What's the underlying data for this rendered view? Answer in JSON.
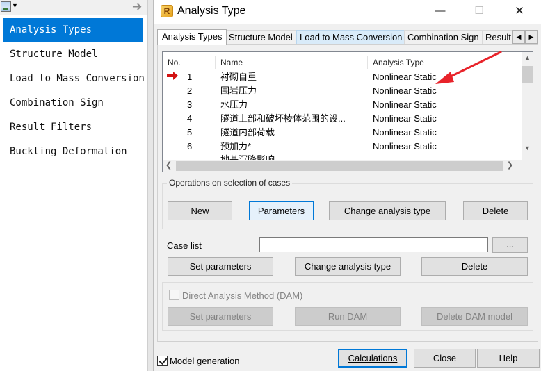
{
  "left_pane": {
    "toolbar": {
      "icon": "view-icon",
      "dropdown_icon": "caret-down-icon",
      "arrow_icon": "arrow-right-icon"
    },
    "items": [
      {
        "label": "Analysis Types",
        "selected": true
      },
      {
        "label": "Structure Model",
        "selected": false
      },
      {
        "label": "Load to Mass Conversion",
        "selected": false
      },
      {
        "label": "Combination Sign",
        "selected": false
      },
      {
        "label": "Result Filters",
        "selected": false
      },
      {
        "label": "Buckling Deformation",
        "selected": false
      }
    ]
  },
  "window": {
    "title": "Analysis Type",
    "app_icon_letter": "R",
    "minimize_glyph": "—",
    "maximize_glyph": "☐",
    "close_glyph": "✕"
  },
  "tabs": [
    {
      "label": "Analysis Types",
      "active": true
    },
    {
      "label": "Structure Model",
      "active": false
    },
    {
      "label": "Load to Mass Conversion",
      "active": false
    },
    {
      "label": "Combination Sign",
      "active": false
    },
    {
      "label": "Result",
      "active": false
    }
  ],
  "case_table": {
    "columns": [
      "No.",
      "Name",
      "Analysis Type"
    ],
    "rows": [
      {
        "no": "1",
        "name": "衬砌自重",
        "type": "Nonlinear Static",
        "current": true
      },
      {
        "no": "2",
        "name": "围岩压力",
        "type": "Nonlinear Static",
        "current": false
      },
      {
        "no": "3",
        "name": "水压力",
        "type": "Nonlinear Static",
        "current": false
      },
      {
        "no": "4",
        "name": "隧道上部和破坏棱体范围的设...",
        "type": "Nonlinear Static",
        "current": false
      },
      {
        "no": "5",
        "name": "隧道内部荷载",
        "type": "Nonlinear Static",
        "current": false
      },
      {
        "no": "6",
        "name": "预加力*",
        "type": "Nonlinear Static",
        "current": false
      },
      {
        "no": "",
        "name": "地基沉降影响",
        "type": "",
        "current": false
      }
    ]
  },
  "operations": {
    "group_label": "Operations on selection of cases",
    "new": "New",
    "parameters": "Parameters",
    "change_type": "Change analysis type",
    "delete": "Delete"
  },
  "case_list": {
    "label": "Case list",
    "value": "",
    "browse": "...",
    "set_parameters": "Set parameters",
    "change_type": "Change analysis type",
    "delete": "Delete"
  },
  "dam": {
    "checkbox_label": "Direct Analysis Method (DAM)",
    "checked": false,
    "set_parameters": "Set parameters",
    "run": "Run DAM",
    "delete_model": "Delete DAM model"
  },
  "footer": {
    "model_generation_label": "Model generation",
    "model_generation_checked": true,
    "calculations": "Calculations",
    "close": "Close",
    "help": "Help"
  },
  "colors": {
    "selection": "#0078d7",
    "annotation_arrow": "#e8232a",
    "row_marker": "#d21212"
  }
}
